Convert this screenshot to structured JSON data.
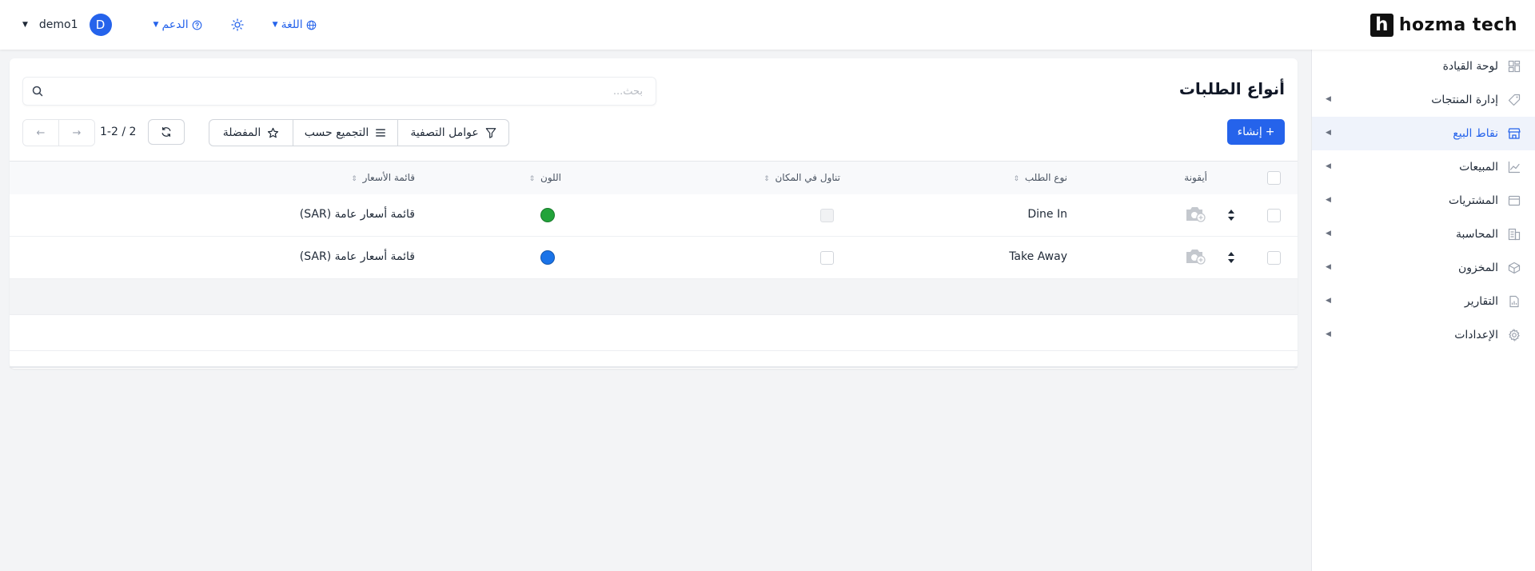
{
  "brand": {
    "logo_letter": "h",
    "name": "hozma tech"
  },
  "topbar": {
    "user_name": "demo1",
    "avatar_initial": "D",
    "support_label": "الدعم",
    "language_label": "اللغة"
  },
  "sidebar": {
    "items": [
      {
        "label": "لوحة القيادة",
        "icon": "dashboard-icon",
        "active": false
      },
      {
        "label": "إدارة المنتجات",
        "icon": "tag-icon",
        "active": false
      },
      {
        "label": "نقاط البيع",
        "icon": "store-icon",
        "active": true
      },
      {
        "label": "المبيعات",
        "icon": "chart-line-icon",
        "active": false
      },
      {
        "label": "المشتريات",
        "icon": "wallet-icon",
        "active": false
      },
      {
        "label": "المحاسبة",
        "icon": "ledger-icon",
        "active": false
      },
      {
        "label": "المخزون",
        "icon": "box-icon",
        "active": false
      },
      {
        "label": "التقارير",
        "icon": "report-icon",
        "active": false
      },
      {
        "label": "الإعدادات",
        "icon": "gear-icon",
        "active": false
      }
    ]
  },
  "page": {
    "title": "أنواع الطلبات",
    "search_placeholder": "بحث...",
    "create_label": "إنشاء",
    "filters_label": "عوامل التصفية",
    "group_by_label": "التجميع حسب",
    "favorites_label": "المفضلة",
    "pager_text": "1-2 / 2"
  },
  "table": {
    "headers": {
      "icon": "أيقونة",
      "order_type": "نوع الطلب",
      "dine_in": "تناول في المكان",
      "color": "اللون",
      "pricelist": "قائمة الأسعار"
    },
    "rows": [
      {
        "order_type": "Dine In",
        "dine_in": true,
        "color": "#22a33a",
        "pricelist": "قائمة أسعار عامة (SAR)"
      },
      {
        "order_type": "Take Away",
        "dine_in": false,
        "color": "#1a73e8",
        "pricelist": "قائمة أسعار عامة (SAR)"
      }
    ]
  },
  "colors": {
    "accent": "#2563eb"
  }
}
